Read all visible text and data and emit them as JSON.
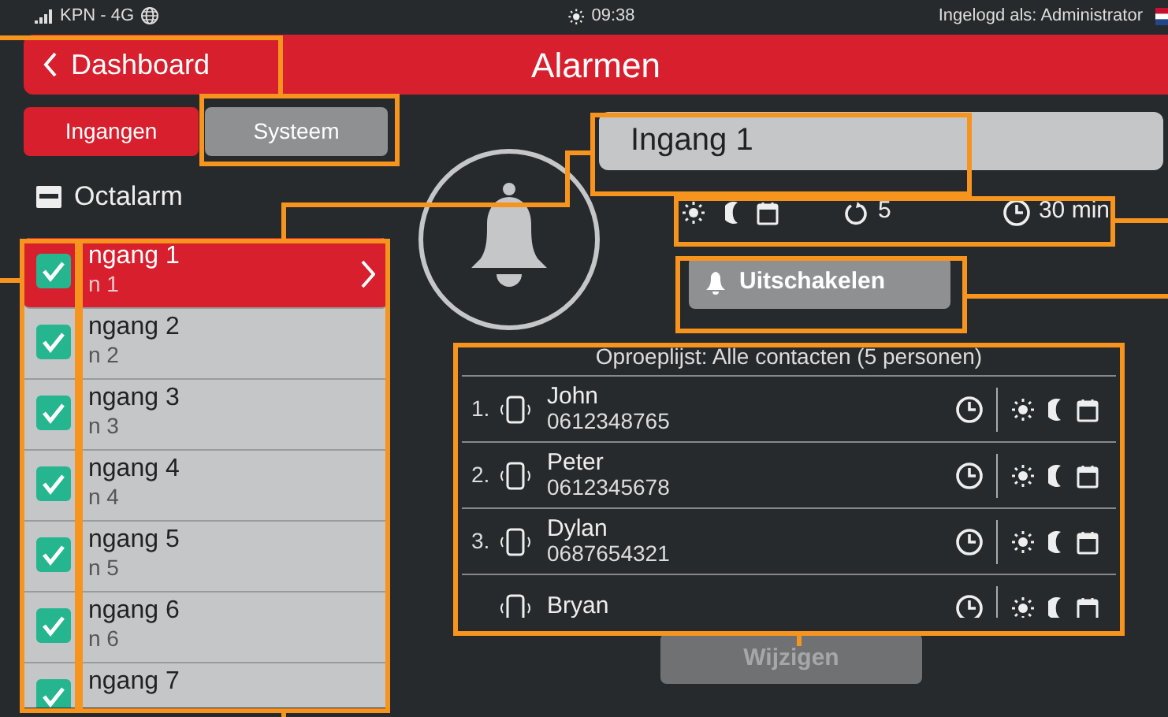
{
  "status_bar": {
    "carrier": "KPN - 4G",
    "time": "09:38",
    "user": "Ingelogd als: Administrator"
  },
  "header": {
    "back": "Dashboard",
    "title": "Alarmen"
  },
  "tabs": [
    {
      "label": "Ingangen",
      "selected": true
    },
    {
      "label": "Systeem",
      "selected": false
    }
  ],
  "device": {
    "label": "Octalarm"
  },
  "inputs": [
    {
      "title": "ngang 1",
      "subtitle": "n 1",
      "checked": true,
      "selected": true
    },
    {
      "title": "ngang 2",
      "subtitle": "n 2",
      "checked": true,
      "selected": false
    },
    {
      "title": "ngang 3",
      "subtitle": "n 3",
      "checked": true,
      "selected": false
    },
    {
      "title": "ngang 4",
      "subtitle": "n 4",
      "checked": true,
      "selected": false
    },
    {
      "title": "ngang 5",
      "subtitle": "n 5",
      "checked": true,
      "selected": false
    },
    {
      "title": "ngang 6",
      "subtitle": "n 6",
      "checked": true,
      "selected": false
    },
    {
      "title": "ngang 7",
      "checked": true,
      "selected": false
    }
  ],
  "detail": {
    "name": "Ingang 1",
    "repeat": "5",
    "duration": "30 min",
    "action": "Uitschakelen"
  },
  "call_list": {
    "title": "Oproeplijst: Alle contacten (5 personen)",
    "contacts": [
      {
        "index": "1.",
        "name": "John",
        "phone": "0612348765"
      },
      {
        "index": "2.",
        "name": "Peter",
        "phone": "0612345678"
      },
      {
        "index": "3.",
        "name": "Dylan",
        "phone": "0687654321"
      },
      {
        "name": "Bryan"
      }
    ]
  },
  "edit_button": {
    "label": "Wijzigen",
    "disabled": true
  }
}
